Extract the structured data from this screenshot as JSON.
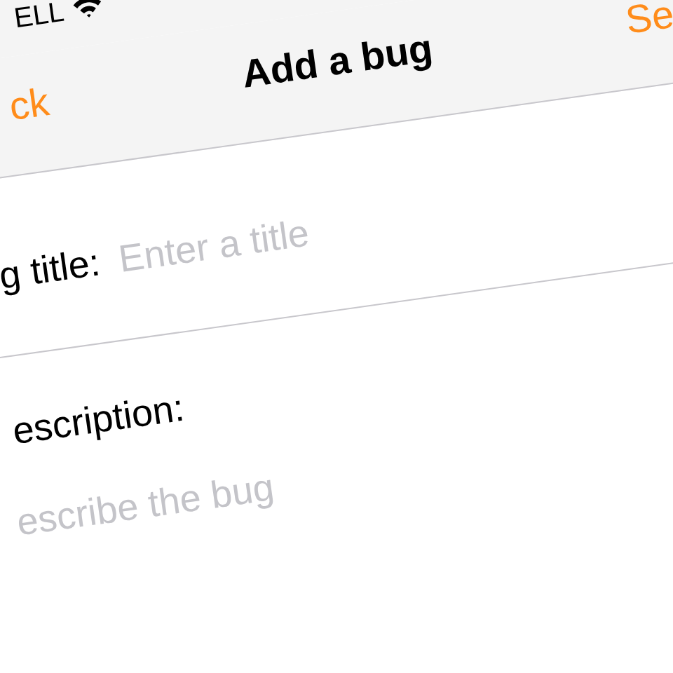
{
  "status_bar": {
    "carrier": "ELL"
  },
  "nav_bar": {
    "back": "ck",
    "title": "Add a bug",
    "action": "Se"
  },
  "form": {
    "title_label": "g title:",
    "title_placeholder": "Enter a title",
    "description_label": "escription:",
    "description_placeholder": "escribe the bug"
  }
}
